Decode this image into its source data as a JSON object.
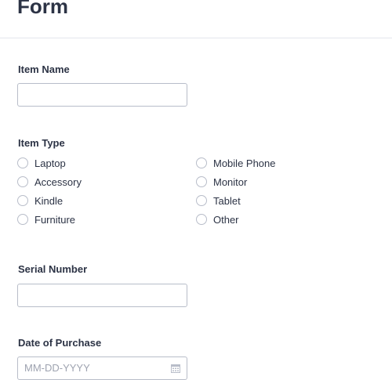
{
  "form": {
    "title": "Form"
  },
  "item_name": {
    "label": "Item Name",
    "value": ""
  },
  "item_type": {
    "label": "Item Type",
    "options_left": [
      "Laptop",
      "Accessory",
      "Kindle",
      "Furniture"
    ],
    "options_right": [
      "Mobile Phone",
      "Monitor",
      "Tablet",
      "Other"
    ]
  },
  "serial_number": {
    "label": "Serial Number",
    "value": ""
  },
  "date_of_purchase": {
    "label": "Date of Purchase",
    "placeholder": "MM-DD-YYYY",
    "icon": "calendar-icon"
  }
}
